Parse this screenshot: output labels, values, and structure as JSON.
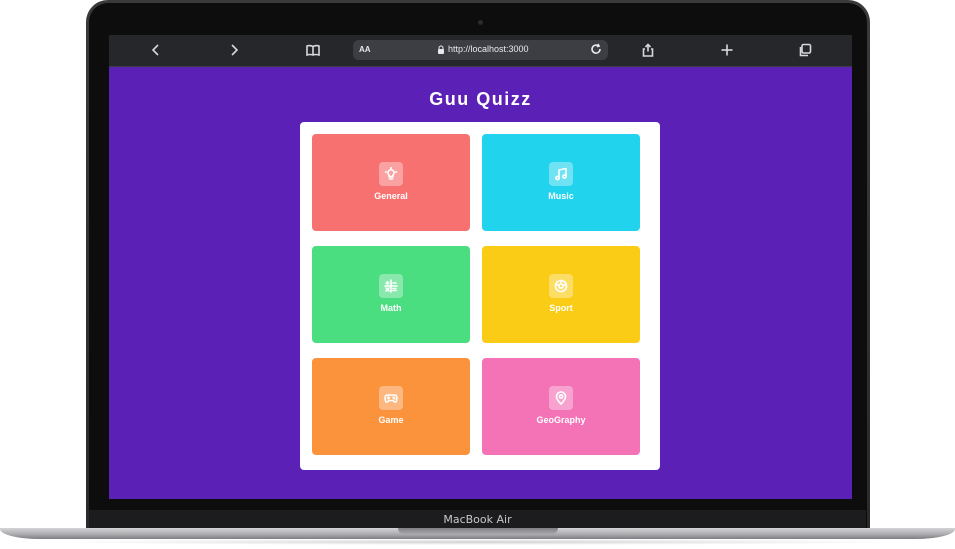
{
  "device": {
    "model_label": "MacBook Air"
  },
  "browser": {
    "text_size_label": "AA",
    "url": "http://localhost:3000",
    "buttons": {
      "back": "back-icon",
      "forward": "forward-icon",
      "bookmarks": "book-icon",
      "reload": "reload-icon",
      "share": "share-icon",
      "new_tab": "plus-icon",
      "tabs": "tabs-icon"
    }
  },
  "app": {
    "title": "Guu Quizz",
    "background_color": "#5b21b6",
    "categories": [
      {
        "label": "General",
        "color": "#f87171",
        "icon": "lightbulb-icon"
      },
      {
        "label": "Music",
        "color": "#22d3ee",
        "icon": "music-note-icon"
      },
      {
        "label": "Math",
        "color": "#4ade80",
        "icon": "math-symbols-icon"
      },
      {
        "label": "Sport",
        "color": "#facc15",
        "icon": "ball-icon"
      },
      {
        "label": "Game",
        "color": "#fb923c",
        "icon": "gamepad-icon"
      },
      {
        "label": "GeoGraphy",
        "color": "#f472b6",
        "icon": "map-pin-icon"
      }
    ]
  }
}
